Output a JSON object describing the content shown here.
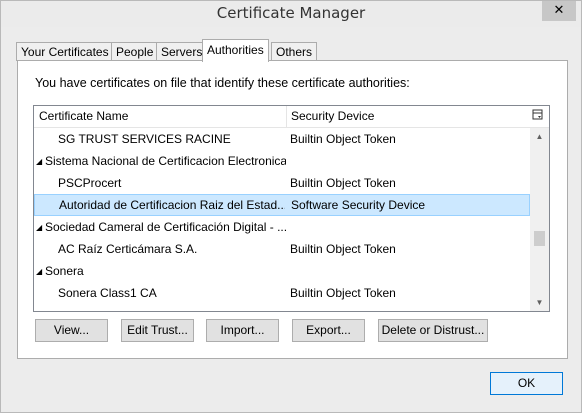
{
  "window": {
    "title": "Certificate Manager",
    "close_glyph": "✕"
  },
  "tabs": [
    {
      "label": "Your Certificates"
    },
    {
      "label": "People"
    },
    {
      "label": "Servers"
    },
    {
      "label": "Authorities"
    },
    {
      "label": "Others"
    }
  ],
  "active_tab": "Authorities",
  "intro_text": "You have certificates on file that identify these certificate authorities:",
  "tree": {
    "columns": [
      "Certificate Name",
      "Security Device"
    ],
    "column_picker_icon": "column-picker-icon",
    "rows": [
      {
        "name": "SG TRUST SERVICES RACINE",
        "device": "Builtin Object Token"
      },
      {
        "name": "Sistema Nacional de Certificacion Electronica",
        "device": ""
      },
      {
        "name": "PSCProcert",
        "device": "Builtin Object Token"
      },
      {
        "name": "Autoridad de Certificacion Raiz del Estad...",
        "device": "Software Security Device"
      },
      {
        "name": "Sociedad Cameral de Certificación Digital - ...",
        "device": ""
      },
      {
        "name": "AC Raíz Certicámara S.A.",
        "device": "Builtin Object Token"
      },
      {
        "name": "Sonera",
        "device": ""
      },
      {
        "name": "Sonera Class1 CA",
        "device": "Builtin Object Token"
      }
    ],
    "expanded_glyph": "◢",
    "scroll_up_glyph": "▲",
    "scroll_down_glyph": "▼"
  },
  "buttons": {
    "view": "View...",
    "edit_trust": "Edit Trust...",
    "import": "Import...",
    "export": "Export...",
    "delete": "Delete or Distrust...",
    "ok": "OK"
  }
}
